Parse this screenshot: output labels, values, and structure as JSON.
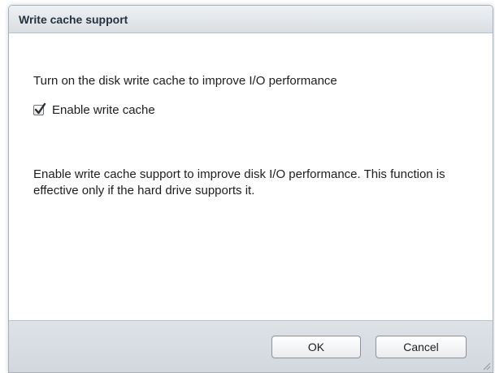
{
  "dialog": {
    "title": "Write cache support",
    "intro_text": "Turn on the disk write cache to improve I/O performance",
    "checkbox": {
      "label": "Enable write cache",
      "checked": true
    },
    "description": "Enable write cache support to improve disk I/O performance. This function is effective only if the hard drive supports it.",
    "buttons": {
      "ok_label": "OK",
      "cancel_label": "Cancel"
    }
  },
  "icons": {
    "check": "checkmark-icon",
    "resize": "resize-grip-icon"
  },
  "colors": {
    "titlebar": "#d9dee3",
    "footer": "#d6dce2",
    "text": "#1e1e1e"
  }
}
